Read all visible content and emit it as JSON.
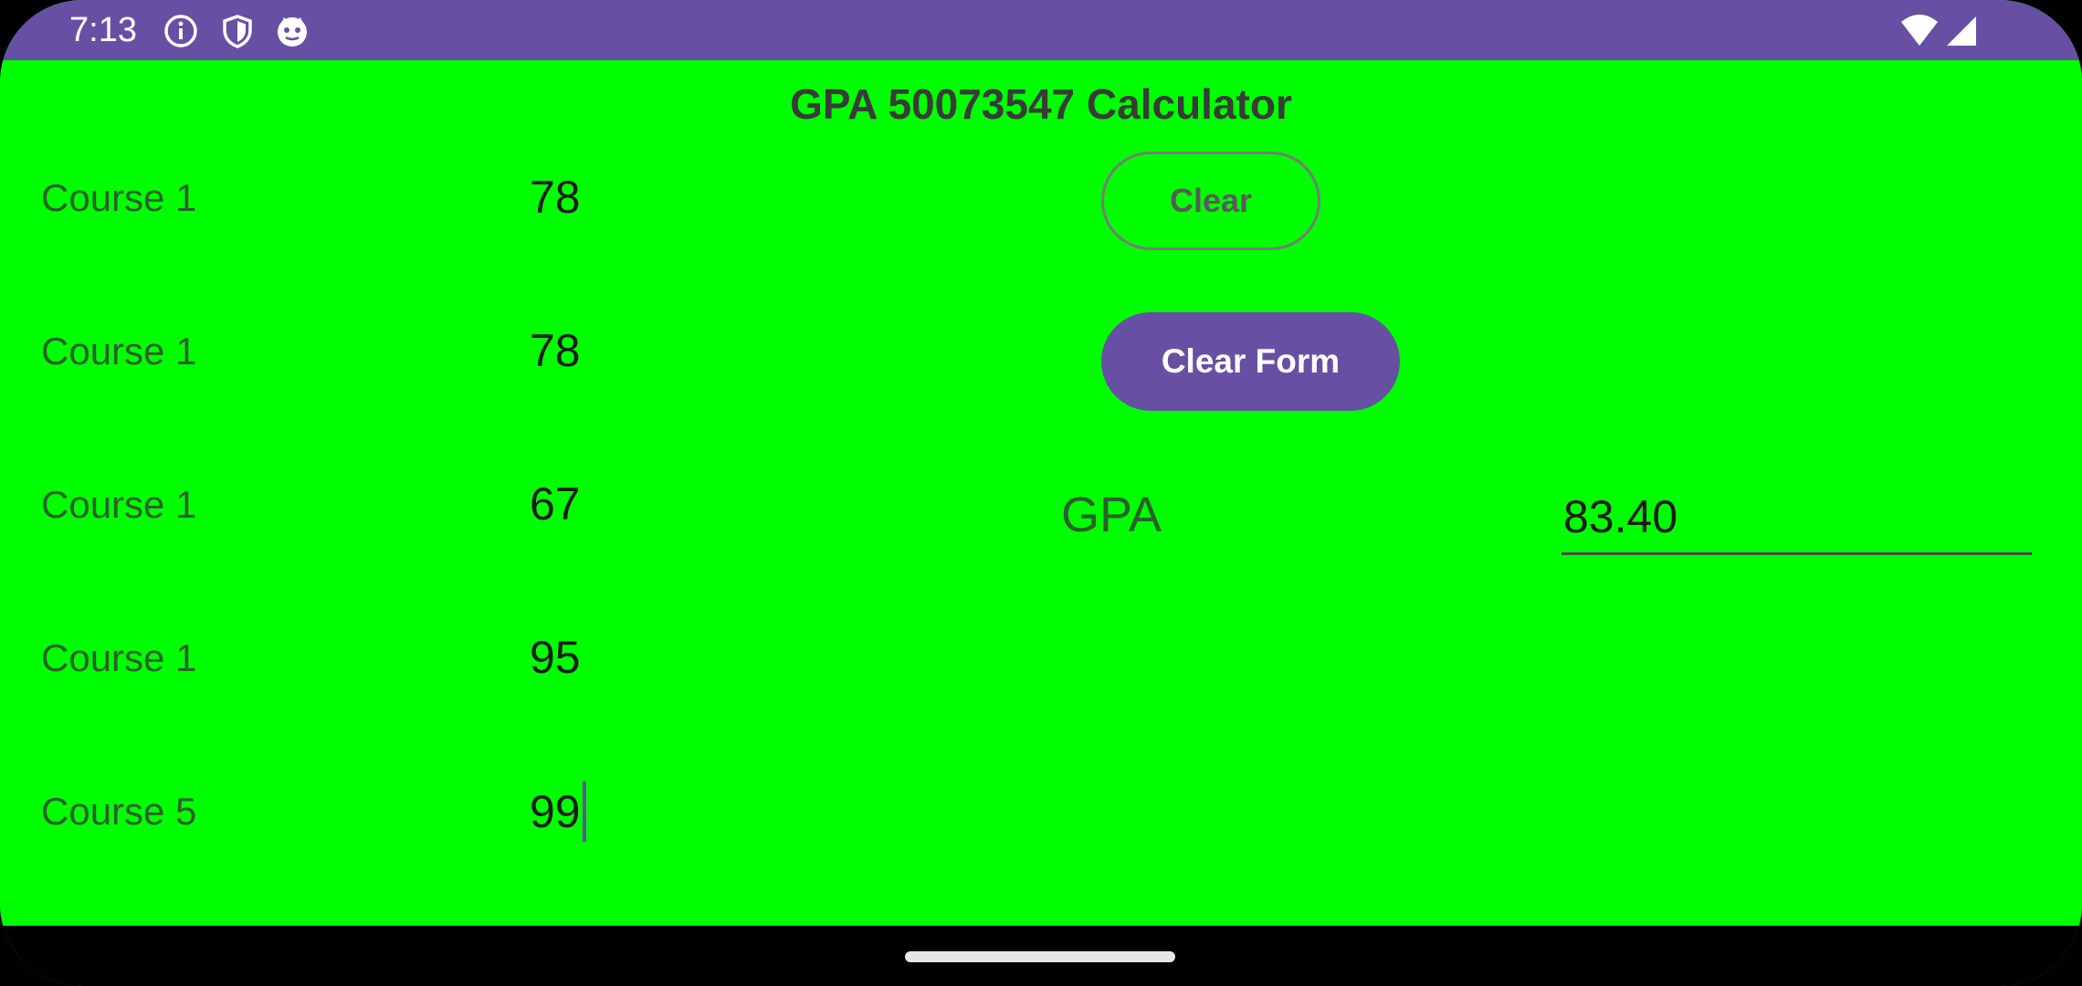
{
  "status_bar": {
    "time": "7:13",
    "left_icons": [
      "info-icon",
      "shield-icon",
      "face-icon"
    ],
    "right_icons": [
      "wifi-icon",
      "cellular-icon"
    ],
    "background": "#6750a4"
  },
  "app": {
    "title": "GPA 50073547 Calculator",
    "background": "#00ff00",
    "accent": "#6750a4"
  },
  "courses": [
    {
      "label": "Course 1",
      "value": "78"
    },
    {
      "label": "Course 1",
      "value": "78"
    },
    {
      "label": "Course 1",
      "value": "67"
    },
    {
      "label": "Course 1",
      "value": "95"
    },
    {
      "label": "Course 5",
      "value": "99"
    }
  ],
  "buttons": {
    "clear": "Clear",
    "clear_form": "Clear Form"
  },
  "gpa": {
    "label": "GPA",
    "value": "83.40"
  }
}
